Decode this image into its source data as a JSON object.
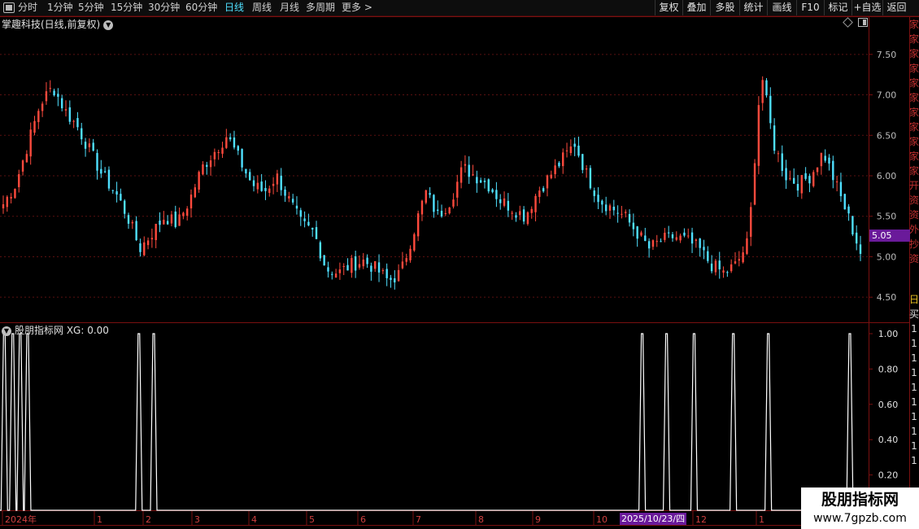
{
  "toolbar": {
    "periods": [
      "分时",
      "1分钟",
      "5分钟",
      "15分钟",
      "30分钟",
      "60分钟",
      "日线",
      "周线",
      "月线",
      "多周期",
      "更多 >"
    ],
    "active_period": "日线",
    "right_buttons": [
      "复权",
      "叠加",
      "多股",
      "统计",
      "画线",
      "F10",
      "标记",
      "+自选",
      "返回"
    ]
  },
  "main_chart": {
    "title": "掌趣科技(日线,前复权)",
    "last_price": "5.05",
    "y_ticks": [
      "7.50",
      "7.00",
      "6.50",
      "6.00",
      "5.50",
      "5.00",
      "4.50"
    ]
  },
  "indicator": {
    "title": "股朋指标网 XG: 0.00",
    "y_ticks": [
      "1.00",
      "0.80",
      "0.60",
      "0.40",
      "0.20"
    ]
  },
  "x_axis": {
    "labels": [
      "2024年",
      "1",
      "2",
      "3",
      "4",
      "5",
      "6",
      "7",
      "8",
      "9",
      "10",
      "12",
      "1"
    ],
    "cursor_date": "2025/10/23/四"
  },
  "right_strip": {
    "chars": [
      "家",
      "家",
      "家",
      "家",
      "家",
      "家",
      "家",
      "家",
      "家",
      "家",
      "家",
      "开",
      "资",
      "资",
      "外",
      "抄",
      "资",
      "",
      "日",
      "买",
      "1",
      "1",
      "1",
      "1",
      "1",
      "1",
      "1",
      "1",
      "1",
      "1"
    ]
  },
  "watermark": {
    "title": "股朋指标网",
    "url": "www.7gpzb.com"
  },
  "colors": {
    "up": "#ff4a3d",
    "down": "#4fe0ff",
    "axis": "#7a1010",
    "grid": "#5a1010",
    "highlight": "#6a1a9a"
  },
  "chart_data": {
    "type": "candlestick",
    "price_closes": [
      5.65,
      5.9,
      6.4,
      6.9,
      7.1,
      6.8,
      6.6,
      6.3,
      6.0,
      5.8,
      5.5,
      5.1,
      5.3,
      5.5,
      5.4,
      5.7,
      6.1,
      6.3,
      6.5,
      6.2,
      5.9,
      5.8,
      6.0,
      5.7,
      5.4,
      5.3,
      4.85,
      4.8,
      4.9,
      4.95,
      4.85,
      4.7,
      4.8,
      5.3,
      5.8,
      5.5,
      5.7,
      6.1,
      6.0,
      5.9,
      5.7,
      5.6,
      5.5,
      5.8,
      6.0,
      6.2,
      6.4,
      6.0,
      5.7,
      5.6,
      5.5,
      5.3,
      5.1,
      5.2,
      5.25,
      5.2,
      5.1,
      4.9,
      4.8,
      4.9,
      5.2,
      7.3,
      6.4,
      6.0,
      5.9,
      6.0,
      6.3,
      5.9,
      5.5,
      5.05
    ],
    "price_ylim": [
      4.2,
      7.8
    ],
    "indicator_name": "XG",
    "indicator_value": 0.0,
    "signal_days": [
      "2024-01-02",
      "2024-01-10",
      "2024-01-17",
      "2024-01-24",
      "2024-05-08",
      "2024-05-22",
      "2025-08-26",
      "2025-09-18",
      "2025-10-14",
      "2025-11-20",
      "2025-12-23",
      "2026-03-10"
    ],
    "indicator_ylim": [
      0,
      1
    ]
  }
}
